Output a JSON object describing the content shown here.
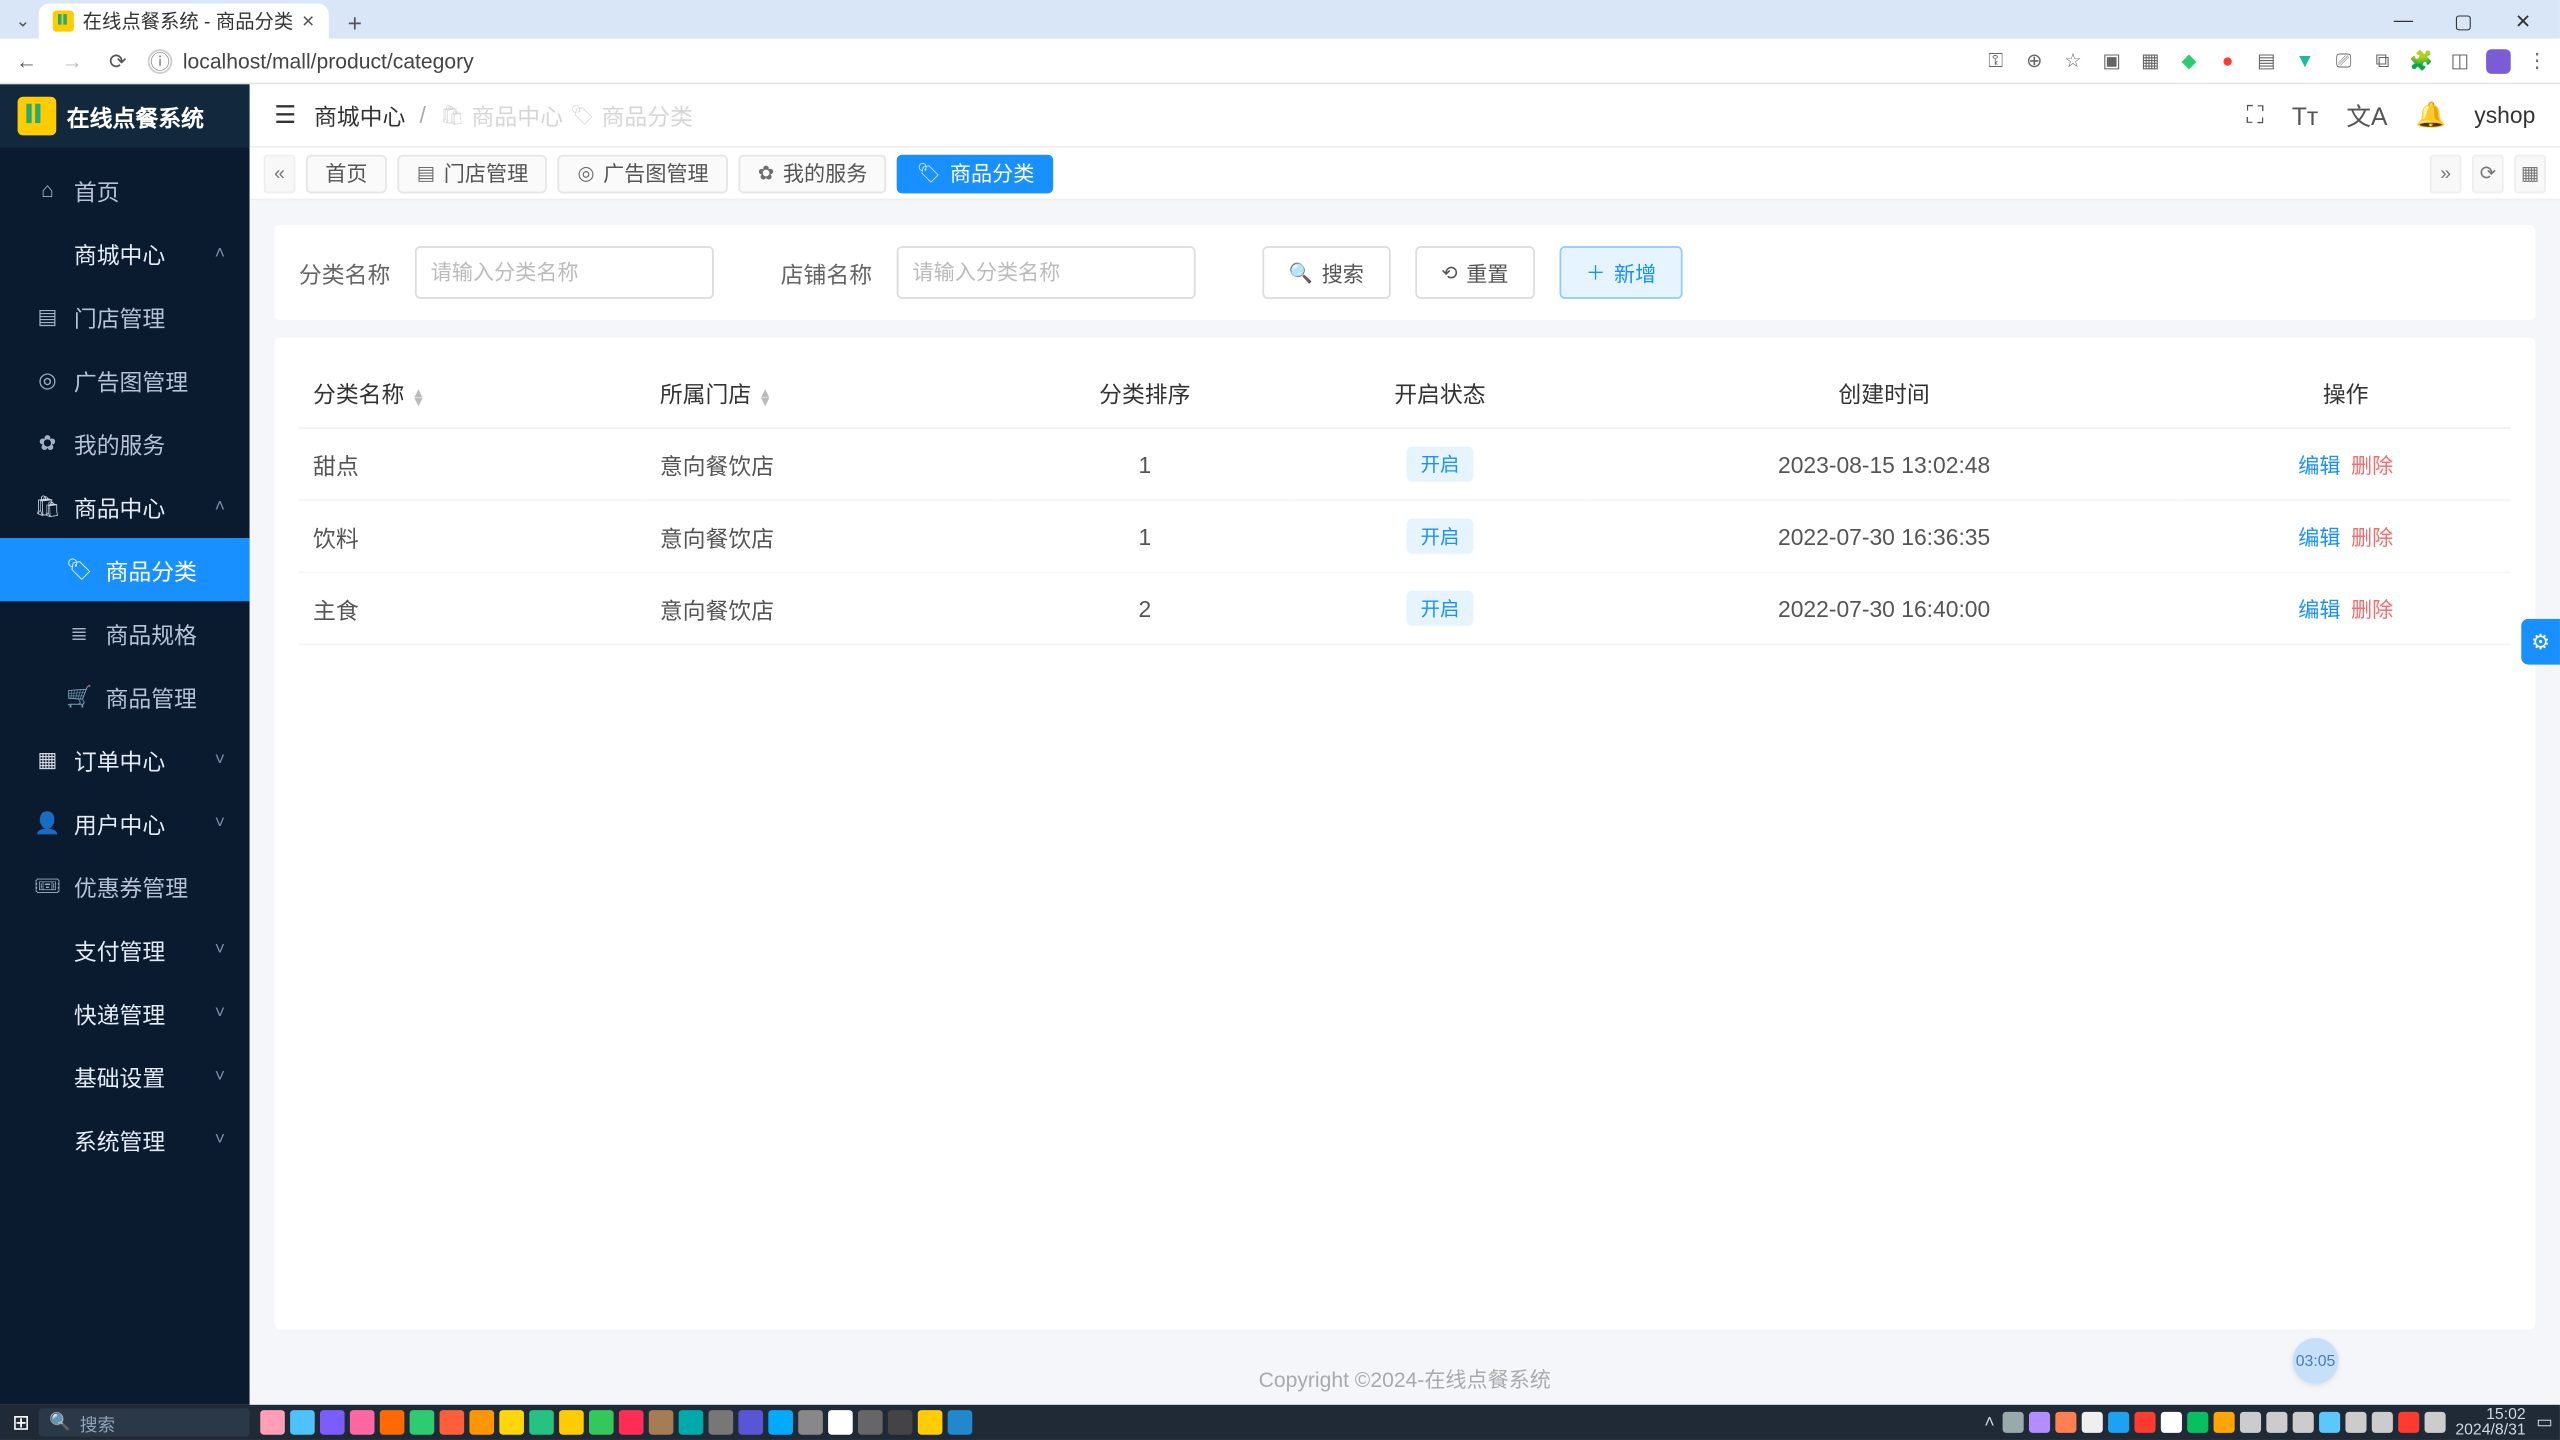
{
  "window": {
    "title": "在线点餐系统 - 商品分类"
  },
  "browser": {
    "url": "localhost/mall/product/category",
    "controls": {
      "min": "—",
      "max": "▢",
      "close": "✕"
    }
  },
  "app": {
    "name": "在线点餐系统",
    "user": "yshop",
    "topbar_tools": {
      "fullscreen": "⛶",
      "font": "Tᴛ",
      "lang": "文A",
      "bell": "🔔"
    },
    "tabs_tools": {
      "prev": "«",
      "next": "»",
      "refresh": "⟳",
      "grid": "▦"
    },
    "breadcrumb": {
      "section": "商城中心",
      "sep": "/",
      "ghost_parent": "商品中心",
      "ghost_current": "商品分类"
    },
    "view_tabs": [
      {
        "icon": "",
        "label": "首页"
      },
      {
        "icon": "▤",
        "label": "门店管理"
      },
      {
        "icon": "◎",
        "label": "广告图管理"
      },
      {
        "icon": "✿",
        "label": "我的服务"
      },
      {
        "icon": "🏷",
        "label": "商品分类",
        "active": true
      }
    ],
    "sidebar": [
      {
        "icon": "⌂",
        "label": "首页",
        "type": "item"
      },
      {
        "icon": "",
        "label": "商城中心",
        "type": "group",
        "expanded": true
      },
      {
        "icon": "▤",
        "label": "门店管理",
        "type": "item",
        "level": 1
      },
      {
        "icon": "◎",
        "label": "广告图管理",
        "type": "item",
        "level": 1
      },
      {
        "icon": "✿",
        "label": "我的服务",
        "type": "item",
        "level": 1
      },
      {
        "icon": "🛍",
        "label": "商品中心",
        "type": "group",
        "level": 1,
        "expanded": true
      },
      {
        "icon": "🏷",
        "label": "商品分类",
        "type": "item",
        "level": 2,
        "active": true
      },
      {
        "icon": "≣",
        "label": "商品规格",
        "type": "item",
        "level": 2
      },
      {
        "icon": "🛒",
        "label": "商品管理",
        "type": "item",
        "level": 2
      },
      {
        "icon": "▦",
        "label": "订单中心",
        "type": "group",
        "level": 1
      },
      {
        "icon": "👤",
        "label": "用户中心",
        "type": "group",
        "level": 1
      },
      {
        "icon": "🎟",
        "label": "优惠券管理",
        "type": "item",
        "level": 1
      },
      {
        "icon": "",
        "label": "支付管理",
        "type": "group"
      },
      {
        "icon": "",
        "label": "快递管理",
        "type": "group"
      },
      {
        "icon": "",
        "label": "基础设置",
        "type": "group"
      },
      {
        "icon": "",
        "label": "系统管理",
        "type": "group"
      }
    ],
    "filters": {
      "name_label": "分类名称",
      "name_placeholder": "请输入分类名称",
      "shop_label": "店铺名称",
      "shop_placeholder": "请输入分类名称",
      "search": "搜索",
      "reset": "重置",
      "add": "新增"
    },
    "table": {
      "columns": {
        "name": "分类名称",
        "shop": "所属门店",
        "sort": "分类排序",
        "status": "开启状态",
        "time": "创建时间",
        "ops": "操作"
      },
      "ops": {
        "edit": "编辑",
        "delete": "删除"
      },
      "rows": [
        {
          "name": "甜点",
          "shop": "意向餐饮店",
          "sort": 1,
          "status": "开启",
          "time": "2023-08-15 13:02:48"
        },
        {
          "name": "饮料",
          "shop": "意向餐饮店",
          "sort": 1,
          "status": "开启",
          "time": "2022-07-30 16:36:35"
        },
        {
          "name": "主食",
          "shop": "意向餐饮店",
          "sort": 2,
          "status": "开启",
          "time": "2022-07-30 16:40:00"
        }
      ]
    },
    "footer": "Copyright ©2024-在线点餐系统",
    "float_timer": "03:05"
  },
  "taskbar": {
    "search": "搜索",
    "app_colors": [
      "#ff9eb5",
      "#4cc2ff",
      "#7a5cff",
      "#ff66a3",
      "#ff6a00",
      "#2ecc71",
      "#ff5e3a",
      "#ff9500",
      "#ffd60a",
      "#26c281",
      "#ffcc00",
      "#34c759",
      "#ff2d55",
      "#a67c52",
      "#0aa",
      "#777",
      "#5856d6",
      "#0af",
      "#888",
      "#fff",
      "#666",
      "#444",
      "#fc0",
      "#28c"
    ],
    "tray_colors": [
      "#9aa",
      "#b48cff",
      "#ff7f50",
      "#efefef",
      "#1da1f2",
      "#ff3b30",
      "#fff",
      "#07c160",
      "#ffa500",
      "#ccc",
      "#ccc",
      "#ccc",
      "#5ac8fa",
      "#ccc",
      "#ccc",
      "#ff3b30",
      "#ccc"
    ],
    "time": "15:02",
    "date": "2024/8/31"
  }
}
